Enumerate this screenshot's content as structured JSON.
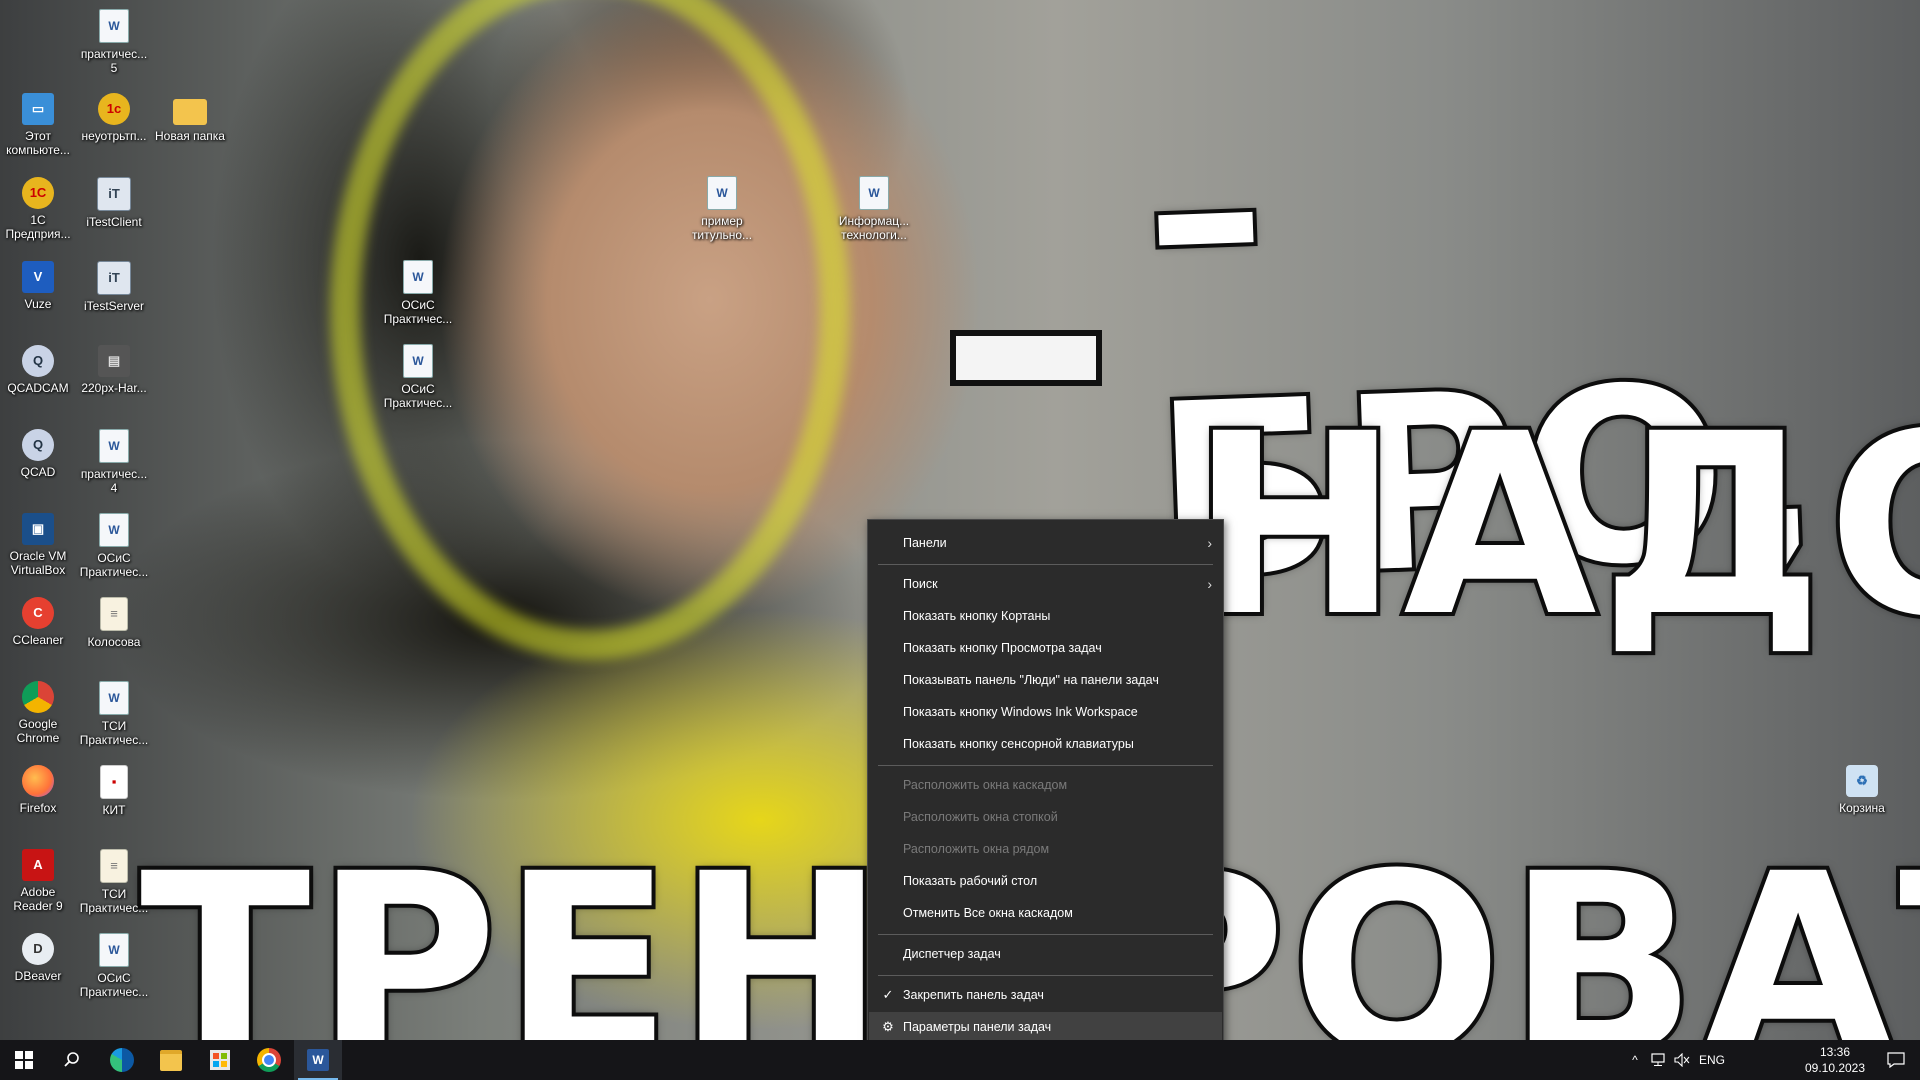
{
  "wallpaper": {
    "lines": [
      "– БРО,",
      "НАДО",
      "ТРЕНИРОВАТЬСЯ"
    ]
  },
  "desktop_icons": [
    {
      "label": "практичес...\n5",
      "icon": "word-doc-icon"
    },
    {
      "label": "Этот\nкомпьюте...",
      "icon": "this-pc-icon"
    },
    {
      "label": "неуотрьтп...",
      "icon": "1c-icon"
    },
    {
      "label": "Новая папка",
      "icon": "folder-icon"
    },
    {
      "label": "1С\nПредприя...",
      "icon": "1c-enterprise-icon"
    },
    {
      "label": "iTestClient",
      "icon": "itest-client-icon"
    },
    {
      "label": "Vuze",
      "icon": "vuze-icon"
    },
    {
      "label": "iTestServer",
      "icon": "itest-server-icon"
    },
    {
      "label": "QCADCAM",
      "icon": "qcadcam-icon"
    },
    {
      "label": "220px-Har...",
      "icon": "image-file-icon"
    },
    {
      "label": "QCAD",
      "icon": "qcad-icon"
    },
    {
      "label": "практичес...\n4",
      "icon": "word-doc-icon"
    },
    {
      "label": "Oracle VM\nVirtualBox",
      "icon": "virtualbox-icon"
    },
    {
      "label": "ОСиС\nПрактичес...",
      "icon": "word-doc-icon"
    },
    {
      "label": "CCleaner",
      "icon": "ccleaner-icon"
    },
    {
      "label": "Колосова",
      "icon": "text-file-icon"
    },
    {
      "label": "Google\nChrome",
      "icon": "chrome-icon"
    },
    {
      "label": "ТСИ\nПрактичес...",
      "icon": "word-doc-icon"
    },
    {
      "label": "Firefox",
      "icon": "firefox-icon"
    },
    {
      "label": "КИТ",
      "icon": "pdf-icon"
    },
    {
      "label": "Adobe\nReader 9",
      "icon": "adobe-reader-icon"
    },
    {
      "label": "ТСИ\nПрактичес...",
      "icon": "text-file-icon"
    },
    {
      "label": "DBeaver",
      "icon": "dbeaver-icon"
    },
    {
      "label": "ОСиС\nПрактичес...",
      "icon": "word-doc-icon"
    },
    {
      "label": "ОСиС\nПрактичес...",
      "icon": "word-doc-icon"
    },
    {
      "label": "ОСиС\nПрактичес...",
      "icon": "word-doc-icon"
    },
    {
      "label": "пример\nтитульно...",
      "icon": "word-doc-icon"
    },
    {
      "label": "Информац...\nтехнологи...",
      "icon": "word-doc-icon"
    },
    {
      "label": "Корзина",
      "icon": "recycle-bin-icon"
    }
  ],
  "context_menu": {
    "items": [
      {
        "label": "Панели",
        "submenu": true
      },
      {
        "label": "Поиск",
        "submenu": true
      },
      {
        "label": "Показать кнопку Кортаны"
      },
      {
        "label": "Показать кнопку Просмотра задач"
      },
      {
        "label": "Показывать панель \"Люди\" на панели задач"
      },
      {
        "label": "Показать кнопку Windows Ink Workspace"
      },
      {
        "label": "Показать кнопку сенсорной клавиатуры"
      },
      {
        "label": "Расположить окна каскадом",
        "disabled": true
      },
      {
        "label": "Расположить окна стопкой",
        "disabled": true
      },
      {
        "label": "Расположить окна рядом",
        "disabled": true
      },
      {
        "label": "Показать рабочий стол"
      },
      {
        "label": "Отменить Все окна каскадом"
      },
      {
        "label": "Диспетчер задач"
      },
      {
        "label": "Закрепить панель задач",
        "checked": true
      },
      {
        "label": "Параметры панели задач",
        "icon": "gear-icon"
      }
    ],
    "arrow_glyph": "›",
    "check_glyph": "✓",
    "gear_glyph": "⚙"
  },
  "taskbar": {
    "apps": [
      "start-button",
      "search-icon",
      "edge-icon",
      "file-explorer-icon",
      "store-icon",
      "chrome-icon",
      "word-icon"
    ],
    "tray": {
      "chevron": "^",
      "language": "ENG",
      "time": "13:36",
      "date": "09.10.2023"
    }
  }
}
